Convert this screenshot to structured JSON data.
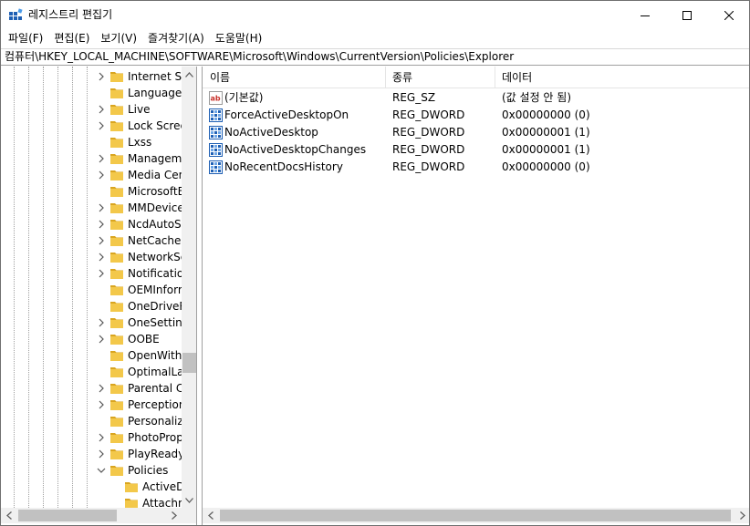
{
  "window": {
    "title": "레지스트리 편집기",
    "icon": "registry-editor-icon",
    "minimize_icon": "minimize-icon",
    "maximize_icon": "maximize-icon",
    "close_icon": "close-icon"
  },
  "menu": [
    {
      "label": "파일(F)"
    },
    {
      "label": "편집(E)"
    },
    {
      "label": "보기(V)"
    },
    {
      "label": "즐겨찾기(A)"
    },
    {
      "label": "도움말(H)"
    }
  ],
  "address": {
    "path": "컴퓨터\\HKEY_LOCAL_MACHINE\\SOFTWARE\\Microsoft\\Windows\\CurrentVersion\\Policies\\Explorer"
  },
  "tree": {
    "items": [
      {
        "label": "Internet Se",
        "expander": "collapsed",
        "indent": 0
      },
      {
        "label": "LanguageC",
        "expander": "none",
        "indent": 0
      },
      {
        "label": "Live",
        "expander": "collapsed",
        "indent": 0
      },
      {
        "label": "Lock Scree",
        "expander": "collapsed",
        "indent": 0
      },
      {
        "label": "Lxss",
        "expander": "none",
        "indent": 0
      },
      {
        "label": "Manageme",
        "expander": "collapsed",
        "indent": 0
      },
      {
        "label": "Media Cent",
        "expander": "collapsed",
        "indent": 0
      },
      {
        "label": "MicrosoftEc",
        "expander": "none",
        "indent": 0
      },
      {
        "label": "MMDevices",
        "expander": "collapsed",
        "indent": 0
      },
      {
        "label": "NcdAutoSe",
        "expander": "collapsed",
        "indent": 0
      },
      {
        "label": "NetCache",
        "expander": "collapsed",
        "indent": 0
      },
      {
        "label": "NetworkSer",
        "expander": "collapsed",
        "indent": 0
      },
      {
        "label": "Notification",
        "expander": "collapsed",
        "indent": 0
      },
      {
        "label": "OEMInform",
        "expander": "none",
        "indent": 0
      },
      {
        "label": "OneDriveRa",
        "expander": "none",
        "indent": 0
      },
      {
        "label": "OneSetting",
        "expander": "collapsed",
        "indent": 0
      },
      {
        "label": "OOBE",
        "expander": "collapsed",
        "indent": 0
      },
      {
        "label": "OpenWith",
        "expander": "none",
        "indent": 0
      },
      {
        "label": "OptimalLay",
        "expander": "none",
        "indent": 0
      },
      {
        "label": "Parental Co",
        "expander": "collapsed",
        "indent": 0
      },
      {
        "label": "Perception",
        "expander": "collapsed",
        "indent": 0
      },
      {
        "label": "Personaliza",
        "expander": "none",
        "indent": 0
      },
      {
        "label": "PhotoPrope",
        "expander": "collapsed",
        "indent": 0
      },
      {
        "label": "PlayReady",
        "expander": "collapsed",
        "indent": 0
      },
      {
        "label": "Policies",
        "expander": "expanded",
        "indent": 0
      },
      {
        "label": "ActiveDe",
        "expander": "none",
        "indent": 1
      },
      {
        "label": "Attachm",
        "expander": "none",
        "indent": 1
      }
    ]
  },
  "list": {
    "columns": [
      {
        "label": "이름"
      },
      {
        "label": "종류"
      },
      {
        "label": "데이터"
      }
    ],
    "rows": [
      {
        "name": "(기본값)",
        "type": "REG_SZ",
        "data": "(값 설정 안 됨)",
        "icon": "string-value-icon"
      },
      {
        "name": "ForceActiveDesktopOn",
        "type": "REG_DWORD",
        "data": "0x00000000 (0)",
        "icon": "binary-value-icon"
      },
      {
        "name": "NoActiveDesktop",
        "type": "REG_DWORD",
        "data": "0x00000001 (1)",
        "icon": "binary-value-icon"
      },
      {
        "name": "NoActiveDesktopChanges",
        "type": "REG_DWORD",
        "data": "0x00000001 (1)",
        "icon": "binary-value-icon"
      },
      {
        "name": "NoRecentDocsHistory",
        "type": "REG_DWORD",
        "data": "0x00000000 (0)",
        "icon": "binary-value-icon"
      }
    ]
  },
  "colors": {
    "folder": "#f3c84a",
    "folder_dark": "#d9a520",
    "icon_blue": "#1e5fb4",
    "icon_red": "#c8312a",
    "scroll_thumb": "#c1c1c1",
    "scroll_track": "#f0f0f0"
  }
}
